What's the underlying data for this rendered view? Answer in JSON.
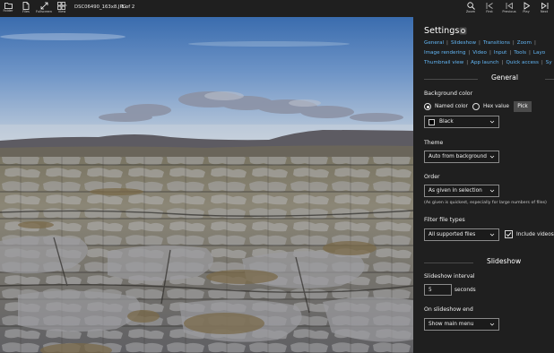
{
  "toolbar": {
    "buttons": {
      "folder": "Folder",
      "files": "Files",
      "fullscreen": "Fullscreen",
      "view": "View",
      "zoom": "Zoom",
      "first": "First",
      "previous": "Previous",
      "play": "Play",
      "next": "Next"
    },
    "file_name": "DSC06490_163x8.JPG",
    "page_count": "1 of 2"
  },
  "settings": {
    "title": "Settings",
    "nav_row1": [
      "General",
      "Slideshow",
      "Transitions",
      "Zoom"
    ],
    "nav_row2": [
      "Image rendering",
      "Video",
      "Input",
      "Tools",
      "Layo"
    ],
    "nav_row3": [
      "Thumbnail view",
      "App launch",
      "Quick access",
      "Sy"
    ],
    "general": {
      "header": "General",
      "background_color_label": "Background color",
      "radio_named": "Named color",
      "radio_hex": "Hex value",
      "pick_button": "Pick",
      "color_value": "Black",
      "theme_label": "Theme",
      "theme_value": "Auto from background",
      "order_label": "Order",
      "order_value": "As given in selection",
      "order_hint": "(As given is quickest, especially for large numbers of files)",
      "filter_label": "Filter file types",
      "filter_value": "All supported files",
      "include_videos": "Include videos"
    },
    "slideshow": {
      "header": "Slideshow",
      "interval_label": "Slideshow interval",
      "interval_value": "5",
      "interval_unit": "seconds",
      "end_label": "On slideshow end",
      "end_value": "Show main menu"
    }
  },
  "colors": {
    "toolbar_bg": "#1f1f1f",
    "panel_bg": "#1f1f1f",
    "link": "#62b6f5",
    "sky_top": "#3d6fb0",
    "sky_bottom": "#b8c8dc"
  }
}
